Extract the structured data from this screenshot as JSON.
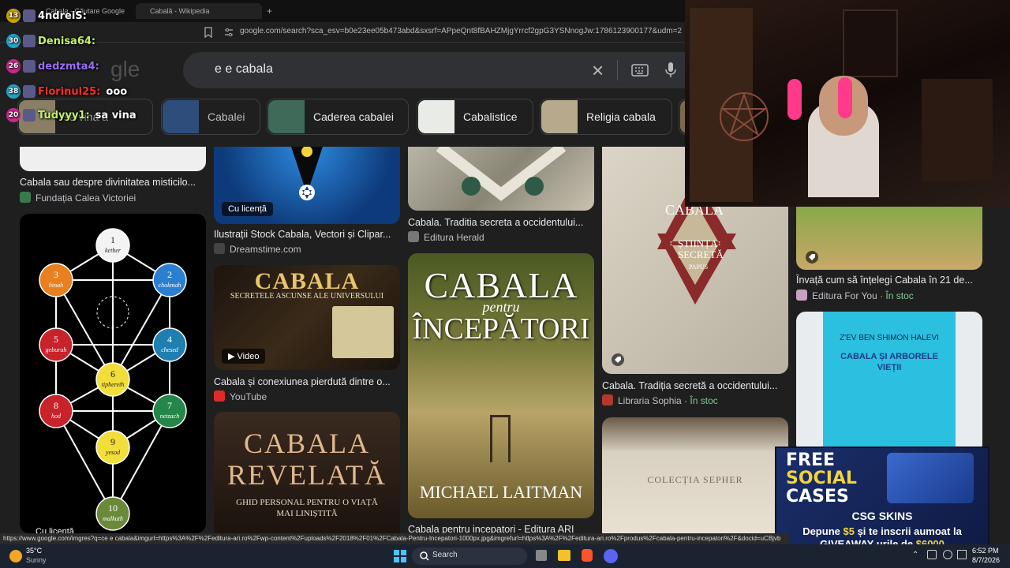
{
  "browser": {
    "tabs": [
      "Cabala - Căutare Google",
      "Cabală - Wikipedia"
    ],
    "new_tab": "+",
    "url": "google.com/search?sca_esv=b0e23ee05b473abd&sxsrf=APpeQnt8fBAHZMjgYrrcf2gpG3YSNnogJw:1786123900177&udm=2&fbs=A8fTb"
  },
  "search": {
    "logo": "gle",
    "query": "e e cabala",
    "clear_icon": "×"
  },
  "chips": [
    {
      "label": "sa vina ă",
      "color": "#8a7f66"
    },
    {
      "label": "Cabalei",
      "color": "#2f4d7a"
    },
    {
      "label": "Caderea cabalei",
      "color": "#3f6a5a"
    },
    {
      "label": "Cabalistice",
      "color": "#e9ece6"
    },
    {
      "label": "Religia cabala",
      "color": "#b6a98c"
    }
  ],
  "results": {
    "col1": [
      {
        "caption": "Cabala sau despre divinitatea misticilo...",
        "source": "Fundația Calea Victoriei",
        "fav_color": "#3a7a4a"
      },
      {
        "badge": "Cu licență"
      }
    ],
    "col2": [
      {
        "badge": "Cu licență",
        "caption": "Ilustrații Stock Cabala, Vectori și Clipar...",
        "source": "Dreamstime.com",
        "fav_color": "#444"
      },
      {
        "title": "CABALA",
        "subtitle": "SECRETELE ASCUNSE ALE UNIVERSULUI",
        "badge": "▶ Video",
        "caption": "Cabala și conexiunea pierdută dintre o...",
        "source": "YouTube",
        "fav_color": "#e02a2a"
      },
      {
        "title": "CABALA REVELATĂ",
        "subtitle": "GHID PERSONAL PENTRU O VIAȚĂ MAI LINIȘTITĂ"
      }
    ],
    "col3": [
      {
        "caption": "Cabala. Traditia secreta a occidentului...",
        "source": "Editura Herald",
        "fav_color": "#777"
      },
      {
        "title": "CABALA",
        "title2": "pentru",
        "title3": "ÎNCEPĂTORI",
        "author": "MICHAEL LAITMAN",
        "caption": "Cabala pentru incepatori - Editura ARI"
      }
    ],
    "col4": [
      {
        "caption": "Cabala. Tradiția secretă a occidentului...",
        "source": "Libraria Sophia",
        "stock": "În stoc",
        "fav_color": "#b33a2a",
        "cover_title": "CABALA",
        "cover_sub": "ȘTIINȚA SECRETĂ",
        "cover_author": "PAPUS"
      },
      {
        "title": "COLECȚIA SEPHER"
      }
    ],
    "col5": [
      {
        "caption": "Învață cum să înțelegi Cabala în 21 de...",
        "source": "Editura For You",
        "stock": "În stoc",
        "fav_color": "#c7a3c0"
      },
      {
        "author": "Z'EV BEN SHIMON HALEVI",
        "title": "CABALA ȘI ARBORELE VIEȚII"
      }
    ]
  },
  "tree": {
    "nodes": [
      {
        "n": "1",
        "name": "kether",
        "color": "#f3f3f3"
      },
      {
        "n": "2",
        "name": "chokmah",
        "color": "#2a7fd0"
      },
      {
        "n": "3",
        "name": "binah",
        "color": "#e8801f"
      },
      {
        "n": "4",
        "name": "chesed",
        "color": "#1f7fb0"
      },
      {
        "n": "5",
        "name": "geburah",
        "color": "#c8222a"
      },
      {
        "n": "6",
        "name": "tiphereth",
        "color": "#f2de3a"
      },
      {
        "n": "7",
        "name": "netzach",
        "color": "#25864a"
      },
      {
        "n": "8",
        "name": "hod",
        "color": "#c8222a"
      },
      {
        "n": "9",
        "name": "yesod",
        "color": "#f2de3a"
      },
      {
        "n": "10",
        "name": "malkuth",
        "color": "#6a8a3a"
      }
    ]
  },
  "chat": [
    {
      "level": "13",
      "level_color": "#c9a300",
      "user": "4ndreiS:",
      "color": "#ffffff",
      "msg": ""
    },
    {
      "level": "30",
      "level_color": "#21a3c8",
      "user": "Denisa64:",
      "color": "#c4f06d",
      "msg": ""
    },
    {
      "level": "26",
      "level_color": "#c82a8a",
      "user": "dedzmta4:",
      "color": "#9b6df0",
      "msg": ""
    },
    {
      "level": "38",
      "level_color": "#21a3c8",
      "user": "Florinul25:",
      "color": "#ff2b2b",
      "msg": "ooo"
    },
    {
      "level": "20",
      "level_color": "#c82a8a",
      "user": "Tudyyy1:",
      "color": "#c4f06d",
      "msg": "sa vina"
    }
  ],
  "promo": {
    "line1": "FREE",
    "line2": "SOCIAL",
    "line3": "CASES",
    "brand": "CSG SKINS",
    "text1": "Depune",
    "amount1": "$5",
    "text2": "și te inscrii aumoat la",
    "text3": "GIVEAWAY-urile de",
    "amount2": "$6000"
  },
  "status_url": "https://www.google.com/imgres?q=ce e cabala&imgurl=https%3A%2F%2Feditura-ari.ro%2Fwp-content%2Fuploads%2F2018%2F01%2FCabala-Pentru-Incepatori-1000px.jpg&imgrefurl=https%3A%2F%2Feditura-ari.ro%2Fprodus%2Fcabala-pentru-incepatori%2F&docid=uCBjvb",
  "taskbar": {
    "weather_temp": "35°C",
    "weather_desc": "Sunny",
    "search": "Search",
    "time": "6:52 PM",
    "date": "8/7/2026"
  },
  "colors": {
    "accent": "#8ab4f8",
    "stock": "#81c995"
  }
}
